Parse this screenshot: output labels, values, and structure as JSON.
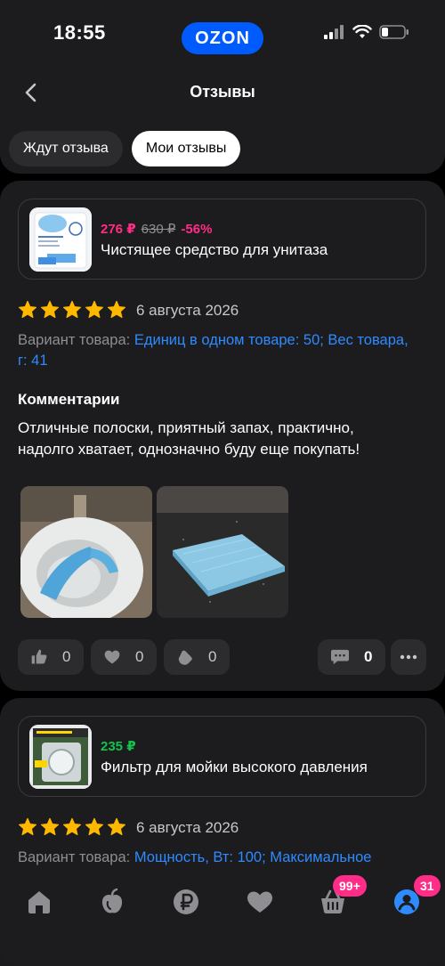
{
  "status": {
    "time": "18:55",
    "app_logo": "OZON"
  },
  "header": {
    "title": "Отзывы",
    "back_icon": "chevron-left-icon"
  },
  "tabs": [
    {
      "label": "Ждут отзыва",
      "active": false
    },
    {
      "label": "Мои отзывы",
      "active": true
    }
  ],
  "reviews": [
    {
      "product": {
        "price": "276 ₽",
        "old_price": "630 ₽",
        "discount": "-56%",
        "name": "Чистящее средство для унитаза"
      },
      "rating": 5,
      "date": "6 августа 2026",
      "variant_label": "Вариант товара:",
      "variant_value": "Единиц в одном товаре: 50; Вес товара, г: 41",
      "comment_title": "Комментарии",
      "comment": "Отличные полоски, приятный запах, практично, надолго хватает, однозначно буду еще покупать!",
      "likes": "0",
      "dislikes": "0",
      "claps": "0",
      "comments_count": "0"
    },
    {
      "product": {
        "price": "235 ₽",
        "name": "Фильтр для мойки высокого давления"
      },
      "rating": 5,
      "date": "6 августа 2026",
      "variant_label": "Вариант товара:",
      "variant_value": "Мощность, Вт: 100; Максимальное"
    }
  ],
  "tabbar": {
    "cart_badge": "99+",
    "profile_badge": "31"
  },
  "colors": {
    "accent": "#005bff",
    "price_pink": "#ff2d87",
    "price_green": "#10c44c",
    "link_blue": "#2e8bff",
    "star": "#ffb800"
  }
}
